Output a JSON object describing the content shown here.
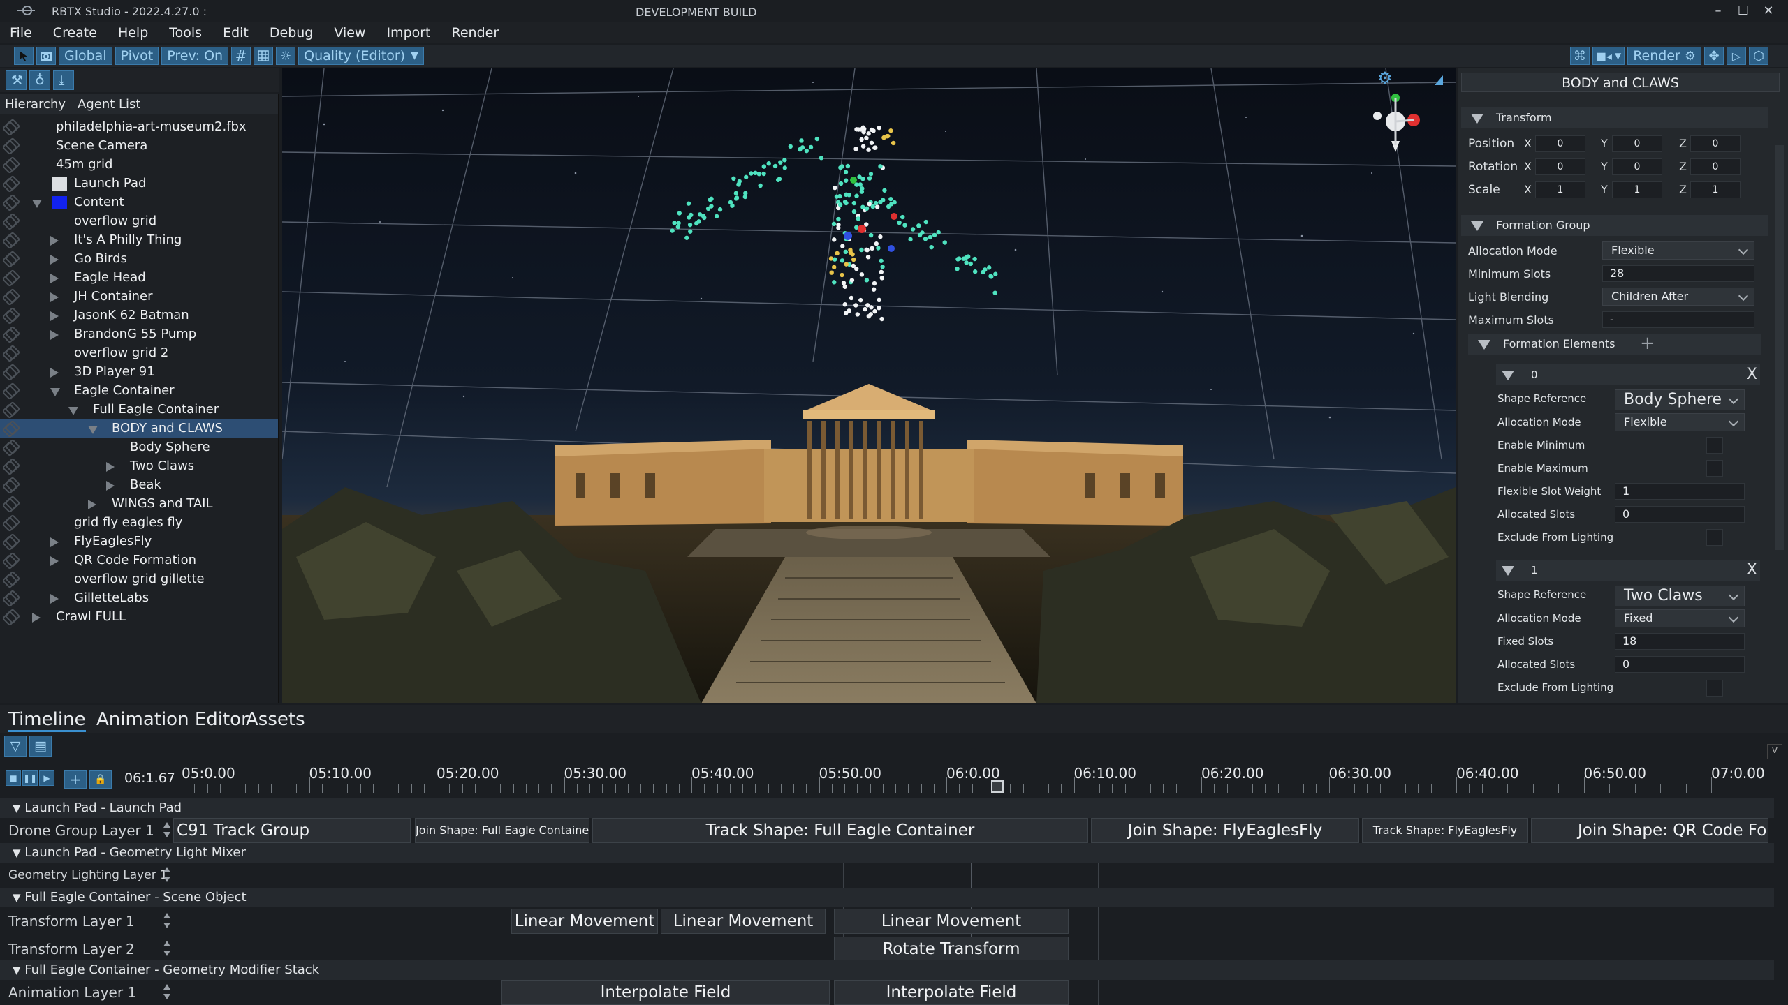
{
  "app": {
    "title": "RBTX Studio  -  2022.4.27.0  :",
    "build": "DEVELOPMENT BUILD"
  },
  "menu": [
    "File",
    "Create",
    "Help",
    "Tools",
    "Edit",
    "Debug",
    "View",
    "Import",
    "Render"
  ],
  "toolbar": {
    "global": "Global",
    "pivot": "Pivot",
    "preview": "Prev: On",
    "quality": "Quality (Editor)",
    "render": "Render"
  },
  "hierarchy": {
    "tabs": [
      "Hierarchy",
      "Agent List"
    ],
    "items": [
      {
        "label": "philadelphia-art-museum2.fbx"
      },
      {
        "label": "Scene Camera"
      },
      {
        "label": "45m grid"
      },
      {
        "label": "Launch Pad"
      },
      {
        "label": "Content"
      },
      {
        "label": "overflow grid"
      },
      {
        "label": "It's A Philly Thing"
      },
      {
        "label": "Go Birds"
      },
      {
        "label": "Eagle Head"
      },
      {
        "label": "JH Container"
      },
      {
        "label": "JasonK 62 Batman"
      },
      {
        "label": "BrandonG 55 Pump"
      },
      {
        "label": "overflow grid 2"
      },
      {
        "label": "3D Player 91"
      },
      {
        "label": "Eagle Container"
      },
      {
        "label": "Full Eagle Container"
      },
      {
        "label": "BODY and CLAWS"
      },
      {
        "label": "Body Sphere"
      },
      {
        "label": "Two Claws"
      },
      {
        "label": "Beak"
      },
      {
        "label": "WINGS and TAIL"
      },
      {
        "label": "grid fly eagles fly"
      },
      {
        "label": "FlyEaglesFly"
      },
      {
        "label": "QR Code Formation"
      },
      {
        "label": "overflow grid gillette"
      },
      {
        "label": "GilletteLabs"
      },
      {
        "label": "Crawl FULL"
      }
    ]
  },
  "inspector": {
    "title": "BODY and CLAWS",
    "transform": {
      "label": "Transform",
      "axes": [
        "X",
        "Y",
        "Z"
      ],
      "rows": [
        {
          "name": "Position",
          "values": [
            "0",
            "0",
            "0"
          ]
        },
        {
          "name": "Rotation",
          "values": [
            "0",
            "0",
            "0"
          ]
        },
        {
          "name": "Scale",
          "values": [
            "1",
            "1",
            "1"
          ]
        }
      ]
    },
    "formation_group": {
      "label": "Formation Group",
      "allocation_mode_label": "Allocation Mode",
      "allocation_mode": "Flexible",
      "minimum_slots_label": "Minimum Slots",
      "minimum_slots": "28",
      "light_blending_label": "Light Blending",
      "light_blending": "Children After",
      "maximum_slots_label": "Maximum Slots",
      "maximum_slots": "-"
    },
    "formation_elements": {
      "label": "Formation Elements",
      "plus": "+",
      "close": "X",
      "el0": {
        "index": "0",
        "shape_ref_label": "Shape Reference",
        "shape_ref": "Body Sphere",
        "alloc_label": "Allocation Mode",
        "alloc": "Flexible",
        "enable_min": "Enable Minimum",
        "enable_max": "Enable Maximum",
        "flex_weight_label": "Flexible Slot Weight",
        "flex_weight": "1",
        "allocated_label": "Allocated Slots",
        "allocated": "0",
        "exclude_label": "Exclude From Lighting"
      },
      "el1": {
        "index": "1",
        "shape_ref_label": "Shape Reference",
        "shape_ref": "Two Claws",
        "alloc_label": "Allocation Mode",
        "alloc": "Fixed",
        "fixed_label": "Fixed Slots",
        "fixed": "18",
        "allocated_label": "Allocated Slots",
        "allocated": "0",
        "exclude_label": "Exclude From Lighting"
      }
    }
  },
  "bottom": {
    "tabs": [
      "Timeline",
      "Animation Editor",
      "Assets"
    ],
    "current_time": "06:1.67",
    "ruler": [
      "05:0.00",
      "05:10.00",
      "05:20.00",
      "05:30.00",
      "05:40.00",
      "05:50.00",
      "06:0.00",
      "06:10.00",
      "06:20.00",
      "06:30.00",
      "06:40.00",
      "06:50.00",
      "07:0.00"
    ],
    "groups": {
      "g1": "Launch Pad - Launch Pad",
      "g2": "Launch Pad - Geometry Light Mixer",
      "g3": "Full Eagle Container - Scene Object",
      "g4": "Full Eagle Container - Geometry Modifier Stack"
    },
    "layers": {
      "drone": "Drone Group Layer 1",
      "geo_light": "Geometry Lighting Layer 1",
      "transform1": "Transform Layer 1",
      "transform2": "Transform Layer 2",
      "anim1": "Animation Layer 1"
    },
    "clips": {
      "c91": "C91 Track Group",
      "join_full": "Join Shape: Full Eagle Container",
      "track_full": "Track Shape: Full Eagle Container",
      "join_fly": "Join Shape: FlyEaglesFly",
      "track_fly": "Track Shape: FlyEaglesFly",
      "join_qr": "Join Shape: QR Code Formation",
      "lin1": "Linear Movement",
      "lin2": "Linear Movement",
      "lin3": "Linear Movement",
      "rot": "Rotate Transform",
      "interp1": "Interpolate Field",
      "interp2": "Interpolate Field"
    }
  },
  "colors": {
    "accent": "#3a90d0",
    "selection": "#2d4e74",
    "drone_teal": "#4fe3c0",
    "drone_white": "#f2f4f6",
    "drone_gold": "#e8c44a"
  }
}
